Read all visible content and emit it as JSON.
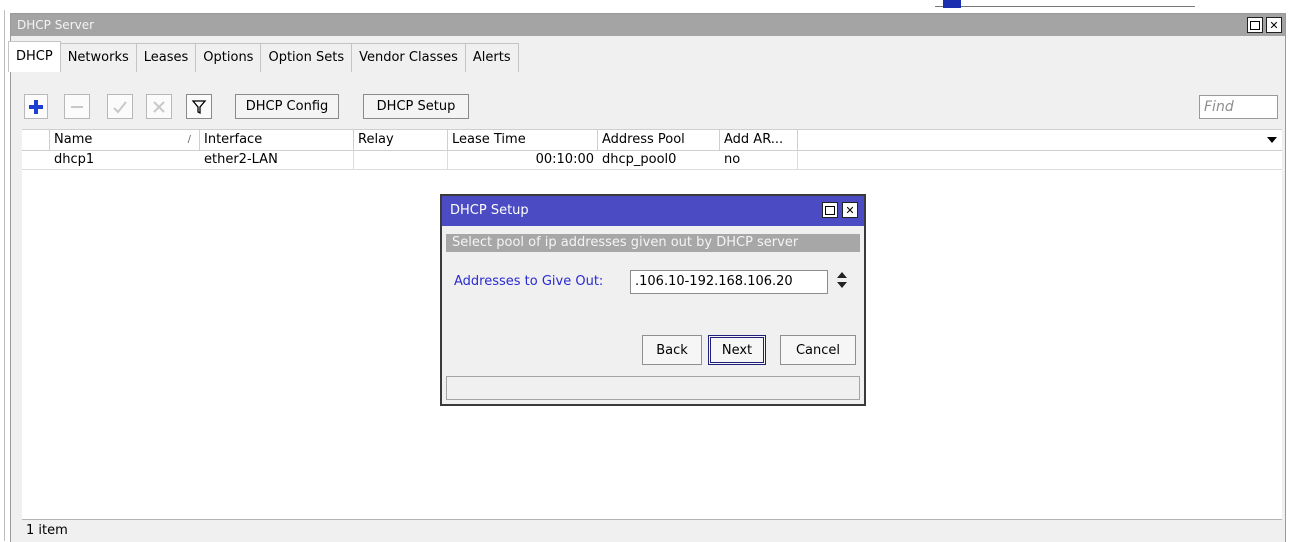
{
  "window": {
    "title": "DHCP Server",
    "find_placeholder": "Find"
  },
  "tabs": [
    "DHCP",
    "Networks",
    "Leases",
    "Options",
    "Option Sets",
    "Vendor Classes",
    "Alerts"
  ],
  "toolbar": {
    "add_icon": "plus-icon",
    "remove_icon": "minus-icon",
    "enable_icon": "check-icon",
    "disable_icon": "cross-icon",
    "filter_icon": "filter-icon",
    "config_label": "DHCP Config",
    "setup_label": "DHCP Setup"
  },
  "table": {
    "columns": [
      "Name",
      "Interface",
      "Relay",
      "Lease Time",
      "Address Pool",
      "Add AR..."
    ],
    "sort_indicator": "/",
    "rows": [
      {
        "name": "dhcp1",
        "interface": "ether2-LAN",
        "relay": "",
        "lease_time": "00:10:00",
        "address_pool": "dhcp_pool0",
        "add_arp": "no"
      }
    ]
  },
  "status": {
    "text": "1 item"
  },
  "dialog": {
    "title": "DHCP Setup",
    "subtitle": "Select pool of ip addresses given out by DHCP server",
    "field_label": "Addresses to Give Out:",
    "field_value": ".106.10-192.168.106.20",
    "back_label": "Back",
    "next_label": "Next",
    "cancel_label": "Cancel"
  },
  "colors": {
    "title_bar": "#a4a4a4",
    "dialog_title_bar": "#4b4bc4",
    "dialog_label": "#2a2ad2",
    "add_icon": "#1a3fd1"
  }
}
